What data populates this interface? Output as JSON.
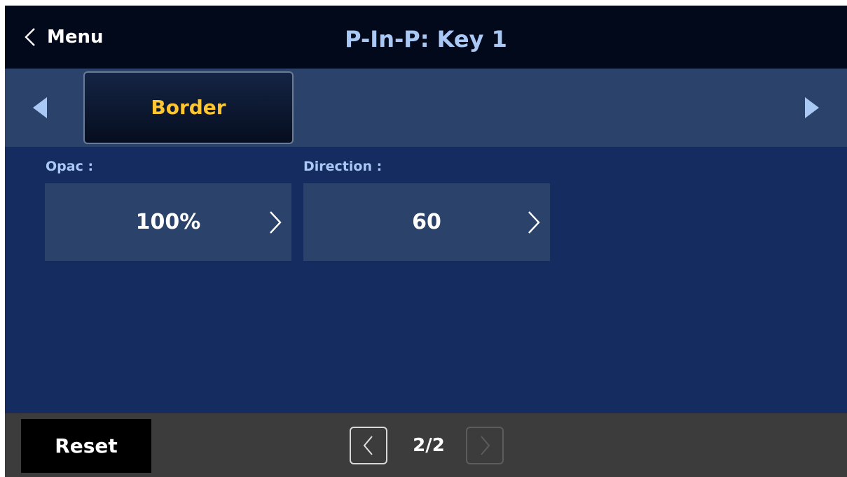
{
  "header": {
    "back_label": "Menu",
    "title": "P-In-P: Key 1"
  },
  "tabs": {
    "active_label": "Border",
    "prev_icon": "triangle-left-icon",
    "next_icon": "triangle-right-icon"
  },
  "params": [
    {
      "label": "Opac :",
      "value": "100%"
    },
    {
      "label": "Direction :",
      "value": "60"
    }
  ],
  "footer": {
    "reset_label": "Reset",
    "page_indicator": "2/2",
    "page_current": 2,
    "page_total": 2
  },
  "colors": {
    "screen_bg": "#152c60",
    "header_bg": "#02091b",
    "title_text": "#a9c9f4",
    "active_tab_text": "#ffc632",
    "panel_bg": "#2b436b",
    "footer_bg": "#3c3c3c"
  }
}
